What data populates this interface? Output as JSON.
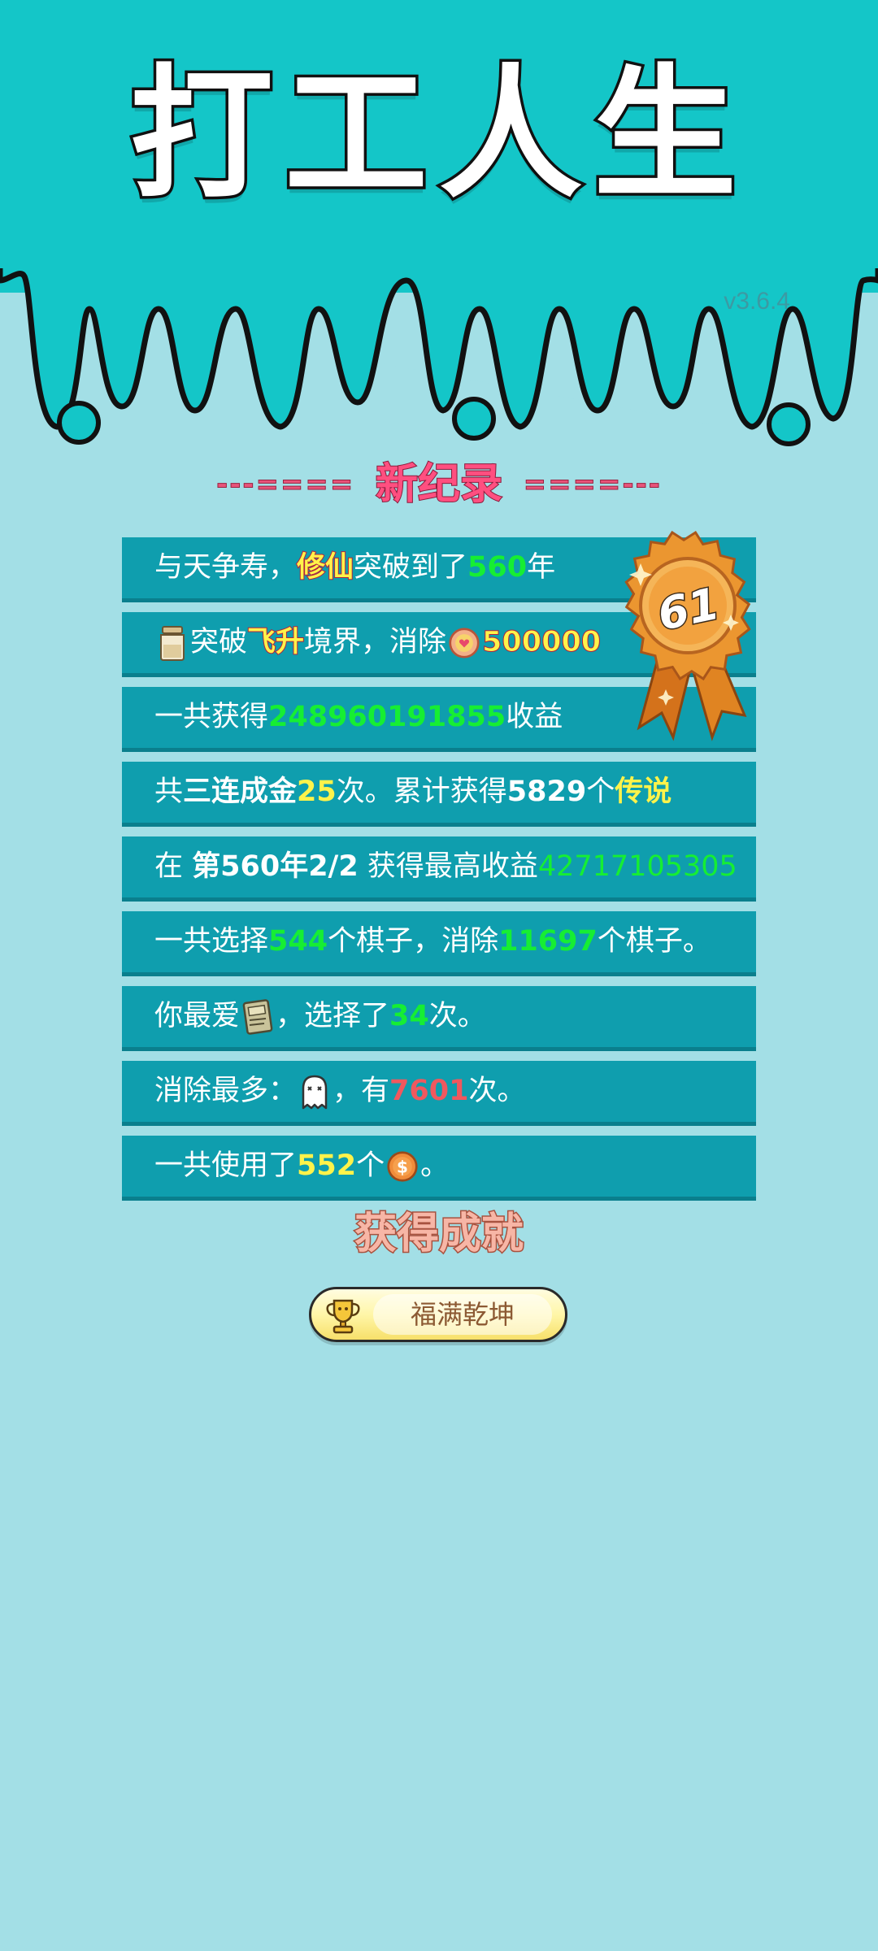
{
  "app": {
    "title": "打工人生",
    "version": "v3.6.4"
  },
  "colors": {
    "header_teal": "#14c6c8",
    "background": "#a3dfe6",
    "row_bg": "#0f9eae",
    "accent_green": "#16ee33",
    "accent_yellow": "#fff34a",
    "accent_red": "#f0585e",
    "heading_pink": "#ff4f80"
  },
  "record": {
    "deco_left": "---====",
    "heading": "新纪录",
    "deco_right": "====---",
    "medal_number": "61"
  },
  "rows": {
    "r1": {
      "a": "与天争寿，",
      "b": "修仙",
      "c": "突破到了",
      "d": "560",
      "e": "年"
    },
    "r2": {
      "icon": "flask-icon",
      "a": "突破",
      "b": "飞升",
      "c": "境界，消除",
      "icon2": "coin-heart-icon",
      "d": "500000"
    },
    "r3": {
      "a": "一共获得",
      "b": "248960191855",
      "c": "收益"
    },
    "r4": {
      "a": "共",
      "b": "三连成金",
      "c": "25",
      "d": "次。累计获得",
      "e": "5829",
      "f": "个",
      "g": "传说"
    },
    "r5": {
      "a": "在 ",
      "b": "第560年2/2",
      "c": " 获得最高收益",
      "d": "42717105305"
    },
    "r6": {
      "a": "一共选择",
      "b": "544",
      "c": "个棋子，消除",
      "d": "11697",
      "e": "个棋子。"
    },
    "r7": {
      "a": "你最爱",
      "icon": "book-icon",
      "b": "，选择了",
      "c": "34",
      "d": "次。"
    },
    "r8": {
      "a": "消除最多：",
      "icon": "ghost-icon",
      "b": "，有",
      "c": "7601",
      "d": "次。"
    },
    "r9": {
      "a": "一共使用了",
      "b": "552",
      "c": "个",
      "icon": "dollar-coin-icon",
      "d": "。"
    }
  },
  "achievement": {
    "heading": "获得成就",
    "icon": "trophy-icon",
    "label": "福满乾坤"
  }
}
